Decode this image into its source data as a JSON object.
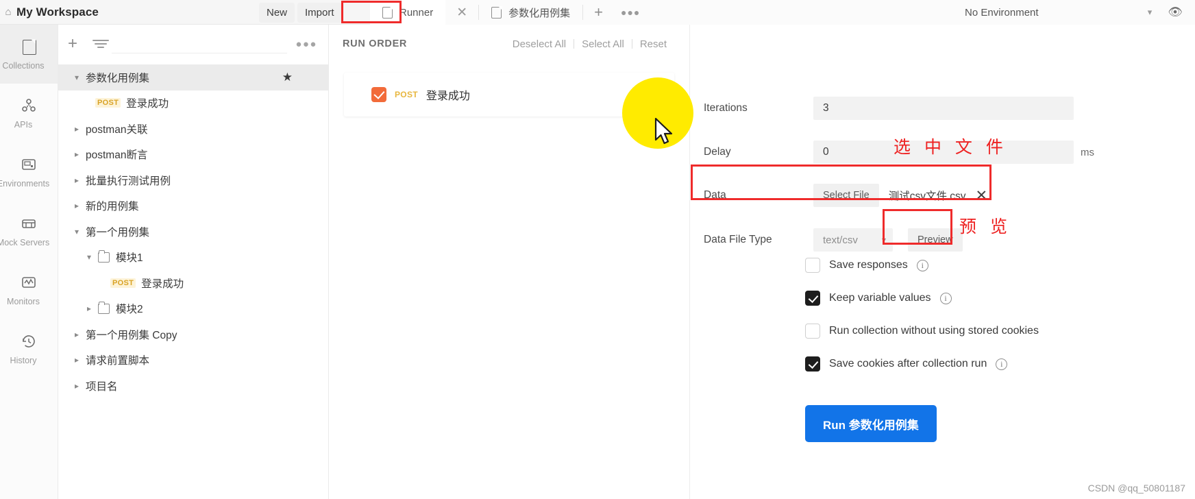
{
  "header": {
    "home_icon": "home-icon",
    "workspace_title": "My Workspace",
    "new_label": "New",
    "import_label": "Import",
    "environment_selected": "No Environment",
    "eye_icon": "eye-icon",
    "caret_icon": "chevron-down-icon"
  },
  "tabs": {
    "items": [
      {
        "label": "Runner",
        "icon": "runner-icon",
        "active": true,
        "highlighted": true
      },
      {
        "label": "参数化用例集",
        "icon": "collection-icon",
        "active": false,
        "highlighted": false
      }
    ],
    "close_icon": "close-icon",
    "add_icon": "plus-icon",
    "more_icon": "more-horizontal-icon"
  },
  "rail": {
    "items": [
      {
        "label": "Collections",
        "icon": "collections-icon",
        "active": true
      },
      {
        "label": "APIs",
        "icon": "apis-icon",
        "active": false
      },
      {
        "label": "Environments",
        "icon": "environments-icon",
        "active": false
      },
      {
        "label": "Mock Servers",
        "icon": "mock-servers-icon",
        "active": false
      },
      {
        "label": "Monitors",
        "icon": "monitors-icon",
        "active": false
      },
      {
        "label": "History",
        "icon": "history-icon",
        "active": false
      }
    ]
  },
  "sidebar": {
    "add_icon": "plus-icon",
    "filter_icon": "filter-icon",
    "more_icon": "more-horizontal-icon",
    "tree": [
      {
        "label": "参数化用例集",
        "type": "collection",
        "expanded": true,
        "selected": true,
        "starred": true,
        "indent": 0
      },
      {
        "label": "登录成功",
        "type": "request",
        "method": "POST",
        "indent": 1
      },
      {
        "label": "postman关联",
        "type": "collection",
        "expanded": false,
        "indent": 0
      },
      {
        "label": "postman断言",
        "type": "collection",
        "expanded": false,
        "indent": 0
      },
      {
        "label": "批量执行测试用例",
        "type": "collection",
        "expanded": false,
        "indent": 0
      },
      {
        "label": "新的用例集",
        "type": "collection",
        "expanded": false,
        "indent": 0
      },
      {
        "label": "第一个用例集",
        "type": "collection",
        "expanded": true,
        "indent": 0
      },
      {
        "label": "模块1",
        "type": "folder",
        "expanded": true,
        "indent": 1
      },
      {
        "label": "登录成功",
        "type": "request",
        "method": "POST",
        "indent": 2
      },
      {
        "label": "模块2",
        "type": "folder",
        "expanded": false,
        "indent": 1
      },
      {
        "label": "第一个用例集 Copy",
        "type": "collection",
        "expanded": false,
        "indent": 0
      },
      {
        "label": "请求前置脚本",
        "type": "collection",
        "expanded": false,
        "indent": 0
      },
      {
        "label": "项目名",
        "type": "collection",
        "expanded": false,
        "indent": 0
      }
    ]
  },
  "runner": {
    "run_order_title": "RUN ORDER",
    "links": [
      "Deselect All",
      "Select All",
      "Reset"
    ],
    "requests": [
      {
        "checked": true,
        "method": "POST",
        "name": "登录成功"
      }
    ]
  },
  "settings": {
    "iterations_label": "Iterations",
    "iterations_value": "3",
    "delay_label": "Delay",
    "delay_value": "0",
    "delay_unit": "ms",
    "data_label": "Data",
    "select_file_label": "Select File",
    "data_file_name": "测试csv文件.csv",
    "clear_file_icon": "close-icon",
    "data_file_type_label": "Data File Type",
    "data_file_type_value": "text/csv",
    "preview_label": "Preview",
    "checkboxes": [
      {
        "label": "Save responses",
        "checked": false,
        "info": true
      },
      {
        "label": "Keep variable values",
        "checked": true,
        "info": true
      },
      {
        "label": "Run collection without using stored cookies",
        "checked": false,
        "info": false
      },
      {
        "label": "Save cookies after collection run",
        "checked": true,
        "info": true
      }
    ],
    "run_button_label": "Run 参数化用例集",
    "run_button_color": "#1274e8"
  },
  "annotations": {
    "select_file_note": "选 中 文 件",
    "preview_note": "预 览",
    "box_color": "#ef2b2b"
  },
  "watermark": "CSDN @qq_50801187"
}
